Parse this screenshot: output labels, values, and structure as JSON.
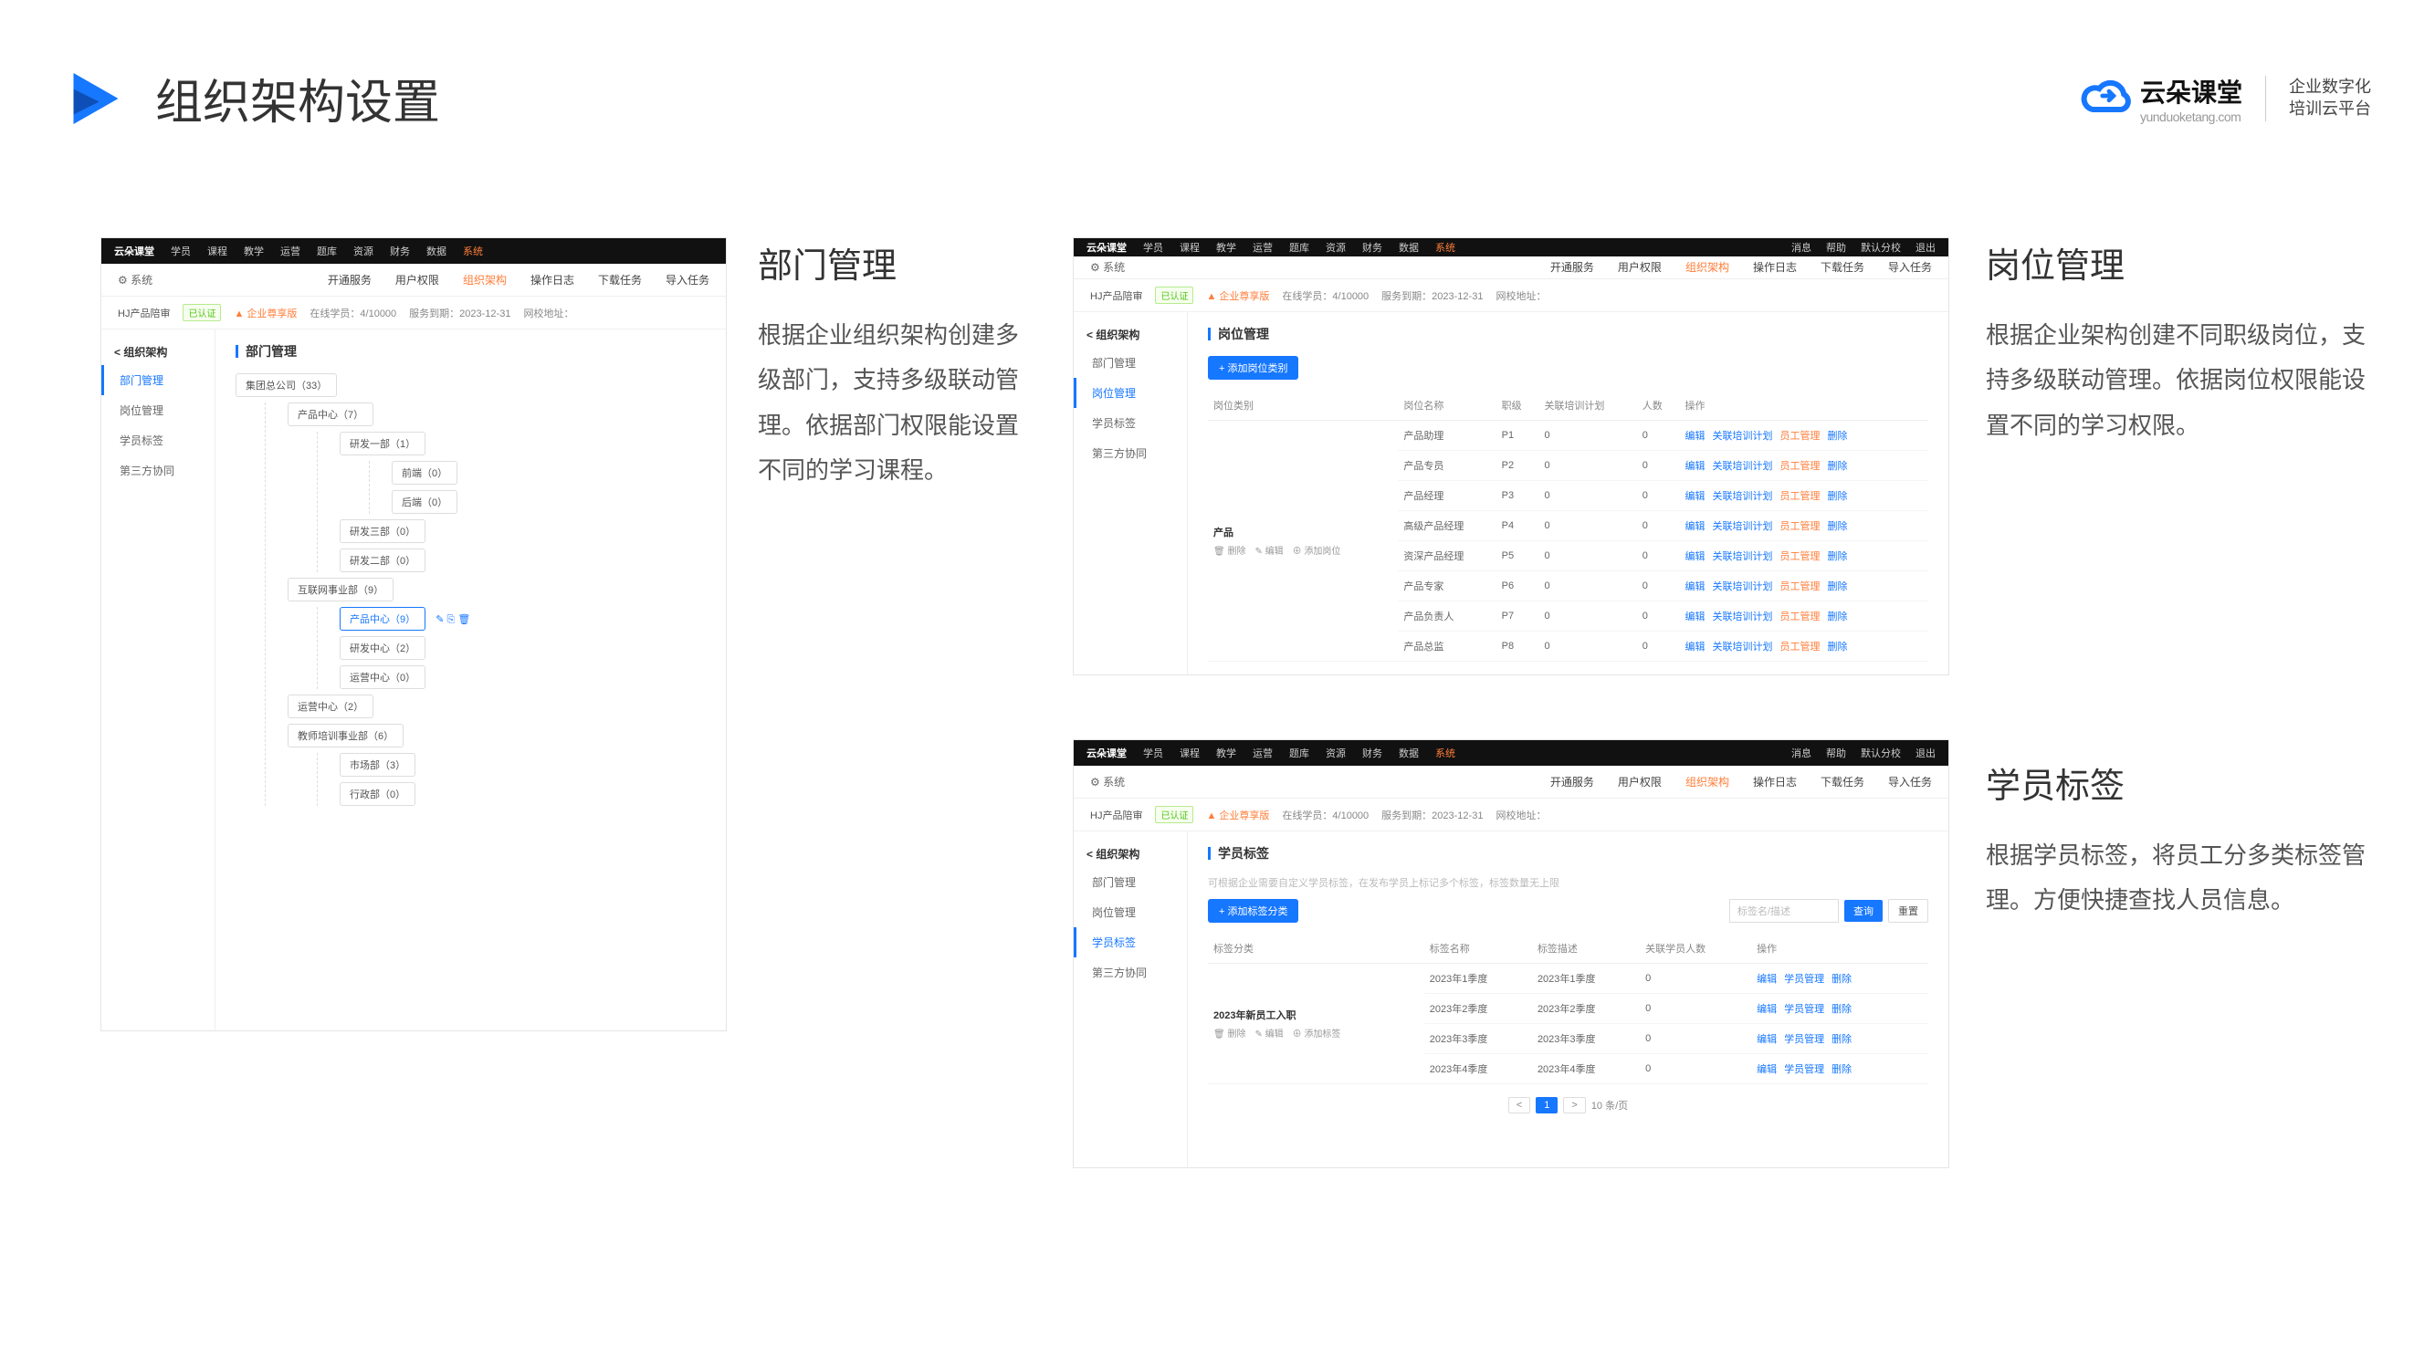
{
  "header": {
    "title": "组织架构设置",
    "logo_main": "云朵课堂",
    "logo_sub": "yunduoketang.com",
    "slogan_l1": "企业数字化",
    "slogan_l2": "培训云平台"
  },
  "common": {
    "topbar": {
      "logo": "云朵课堂",
      "items": [
        "学员",
        "课程",
        "教学",
        "运营",
        "题库",
        "资源",
        "财务",
        "数据",
        "系统"
      ],
      "right": [
        "消息",
        "帮助",
        "默认分校",
        "退出"
      ]
    },
    "subbar": {
      "system": "系统",
      "items": [
        "开通服务",
        "用户权限",
        "组织架构",
        "操作日志",
        "下载任务",
        "导入任务"
      ]
    },
    "infobar": {
      "org": "HJ产品陪审",
      "verified": "已认证",
      "plan": "企业尊享版",
      "students": "在线学员：4/10000",
      "expire": "服务到期：2023-12-31",
      "url": "网校地址："
    },
    "sidebar": {
      "back": "< 组织架构",
      "items": [
        "部门管理",
        "岗位管理",
        "学员标签",
        "第三方协同"
      ]
    }
  },
  "section1": {
    "title": "部门管理",
    "desc": "根据企业组织架构创建多级部门，支持多级联动管理。依据部门权限能设置不同的学习课程。",
    "content_title": "部门管理",
    "tree": {
      "root": "集团总公司（33）",
      "product_center": "产品中心（7）",
      "rd1": "研发一部（1）",
      "frontend": "前端（0）",
      "backend": "后端（0）",
      "rd3": "研发三部（0）",
      "rd2": "研发二部（0）",
      "internet": "互联网事业部（9）",
      "product_center2": "产品中心（9）",
      "rd_center": "研发中心（2）",
      "ops_center": "运营中心（0）",
      "ops_center2": "运营中心（2）",
      "teacher_training": "教师培训事业部（6）",
      "marketing": "市场部（3）",
      "admin": "行政部（0）"
    }
  },
  "section2": {
    "title": "岗位管理",
    "desc": "根据企业架构创建不同职级岗位，支持多级联动管理。依据岗位权限能设置不同的学习权限。",
    "content_title": "岗位管理",
    "add_btn": "+ 添加岗位类别",
    "headers": [
      "岗位类别",
      "岗位名称",
      "职级",
      "关联培训计划",
      "人数",
      "操作"
    ],
    "category": {
      "name": "产品",
      "tools": [
        "删除",
        "编辑",
        "添加岗位"
      ]
    },
    "rows": [
      {
        "name": "产品助理",
        "level": "P1",
        "plan": 0,
        "count": 0
      },
      {
        "name": "产品专员",
        "level": "P2",
        "plan": 0,
        "count": 0
      },
      {
        "name": "产品经理",
        "level": "P3",
        "plan": 0,
        "count": 0
      },
      {
        "name": "高级产品经理",
        "level": "P4",
        "plan": 0,
        "count": 0
      },
      {
        "name": "资深产品经理",
        "level": "P5",
        "plan": 0,
        "count": 0
      },
      {
        "name": "产品专家",
        "level": "P6",
        "plan": 0,
        "count": 0
      },
      {
        "name": "产品负责人",
        "level": "P7",
        "plan": 0,
        "count": 0
      },
      {
        "name": "产品总监",
        "level": "P8",
        "plan": 0,
        "count": 0
      }
    ],
    "ops": [
      "编辑",
      "关联培训计划",
      "员工管理",
      "删除"
    ]
  },
  "section3": {
    "title": "学员标签",
    "desc": "根据学员标签，将员工分多类标签管理。方便快捷查找人员信息。",
    "content_title": "学员标签",
    "note": "可根据企业需要自定义学员标签，在发布学员上标记多个标签，标签数量无上限",
    "add_btn": "+ 添加标签分类",
    "search_placeholder": "标签名/描述",
    "search_btn": "查询",
    "reset_btn": "重置",
    "headers": [
      "标签分类",
      "标签名称",
      "标签描述",
      "关联学员人数",
      "操作"
    ],
    "category": {
      "name": "2023年新员工入职",
      "tools": [
        "删除",
        "编辑",
        "添加标签"
      ]
    },
    "rows": [
      {
        "name": "2023年1季度",
        "desc": "2023年1季度",
        "count": 0
      },
      {
        "name": "2023年2季度",
        "desc": "2023年2季度",
        "count": 0
      },
      {
        "name": "2023年3季度",
        "desc": "2023年3季度",
        "count": 0
      },
      {
        "name": "2023年4季度",
        "desc": "2023年4季度",
        "count": 0
      }
    ],
    "ops": [
      "编辑",
      "学员管理",
      "删除"
    ],
    "pagination": {
      "prev": "<",
      "page": "1",
      "next": ">",
      "per": "10 条/页"
    }
  }
}
